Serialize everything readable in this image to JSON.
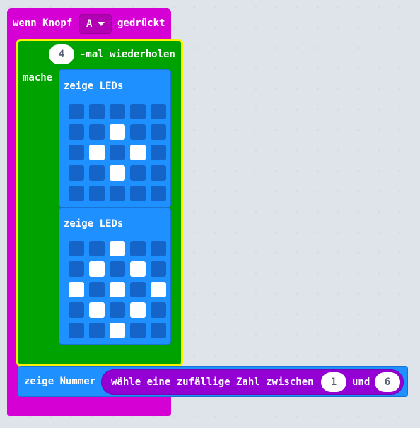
{
  "event_block": {
    "prefix": "wenn Knopf",
    "button_value": "A",
    "suffix": "gedrückt"
  },
  "repeat_block": {
    "count": "4",
    "label": "-mal wiederholen",
    "do_label": "mache"
  },
  "show_leds_1": {
    "label": "zeige LEDs",
    "grid": [
      [
        0,
        0,
        0,
        0,
        0
      ],
      [
        0,
        0,
        1,
        0,
        0
      ],
      [
        0,
        1,
        0,
        1,
        0
      ],
      [
        0,
        0,
        1,
        0,
        0
      ],
      [
        0,
        0,
        0,
        0,
        0
      ]
    ]
  },
  "show_leds_2": {
    "label": "zeige LEDs",
    "grid": [
      [
        0,
        0,
        1,
        0,
        0
      ],
      [
        0,
        1,
        0,
        1,
        0
      ],
      [
        1,
        0,
        1,
        0,
        1
      ],
      [
        0,
        1,
        0,
        1,
        0
      ],
      [
        0,
        0,
        1,
        0,
        0
      ]
    ]
  },
  "show_number_block": {
    "label": "zeige Nummer",
    "random_label": "wähle eine zufällige Zahl zwischen",
    "min": "1",
    "and_label": "und",
    "max": "6"
  },
  "colors": {
    "event": "#d400d4",
    "loop": "#00a200",
    "basic": "#1e90ff",
    "math": "#9400d3",
    "selected_outline": "#fff200",
    "led_off": "#1565c8",
    "led_on": "#ffffff"
  }
}
